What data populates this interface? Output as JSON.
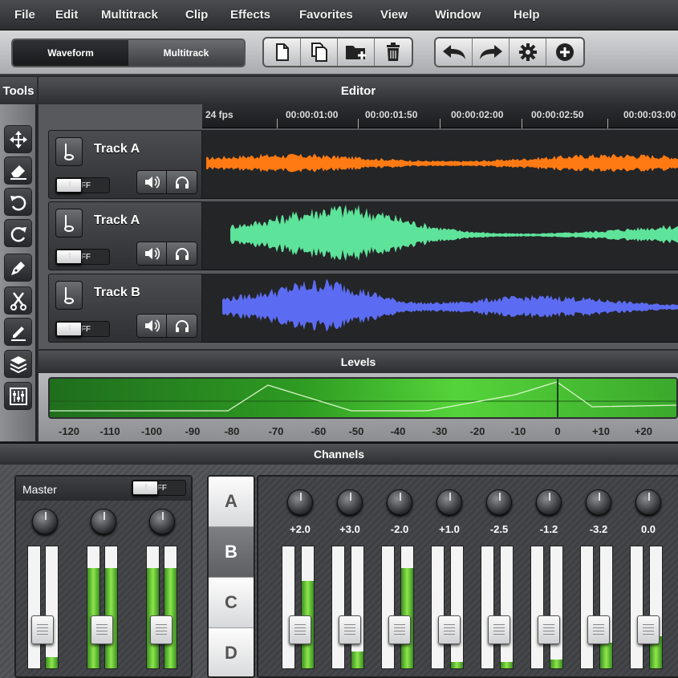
{
  "menu": [
    "File",
    "Edit",
    "Multitrack",
    "Clip",
    "Effects",
    "Favorites",
    "View",
    "Window",
    "Help"
  ],
  "view_tabs": {
    "waveform": "Waveform",
    "multitrack": "Multitrack"
  },
  "file_buttons": [
    "new-file-icon",
    "copy-icon",
    "new-folder-icon",
    "trash-icon"
  ],
  "action_buttons": [
    "undo-icon",
    "redo-icon",
    "settings-icon",
    "add-icon"
  ],
  "tools_title": "Tools",
  "tools": [
    "move-icon",
    "eraser-icon",
    "rotate-left-icon",
    "rotate-right-icon",
    "pen-icon",
    "scissors-icon",
    "pencil-icon",
    "layers-icon",
    "mixer-icon"
  ],
  "editor": {
    "title": "Editor",
    "fps": "24 fps",
    "timecodes": [
      "00:00:01:00",
      "00:00:01:50",
      "00:00:02:00",
      "00:00:02:50",
      "00:00:03:00"
    ],
    "tracks": [
      {
        "name": "Track A",
        "toggle": "OFF",
        "color": "#ff7a12"
      },
      {
        "name": "Track A",
        "toggle": "OFF",
        "color": "#5ee39a"
      },
      {
        "name": "Track B",
        "toggle": "OFF",
        "color": "#5b6cf2"
      }
    ]
  },
  "levels": {
    "title": "Levels",
    "scale": [
      "-120",
      "-110",
      "-100",
      "-90",
      "-80",
      "-70",
      "-60",
      "-50",
      "-40",
      "-30",
      "-20",
      "-10",
      "0",
      "+10",
      "+20"
    ]
  },
  "channels": {
    "title": "Channels",
    "master": {
      "label": "Master",
      "toggle": "OFF",
      "fader_levels": [
        0.09,
        0.82,
        0.82
      ]
    },
    "banks": [
      "A",
      "B",
      "C",
      "D"
    ],
    "selected_bank": "B",
    "strips": [
      {
        "value": "+2.0",
        "level": 0.72
      },
      {
        "value": "+3.0",
        "level": 0.14
      },
      {
        "value": "-2.0",
        "level": 0.82
      },
      {
        "value": "+1.0",
        "level": 0.05
      },
      {
        "value": "-2.5",
        "level": 0.05
      },
      {
        "value": "-1.2",
        "level": 0.07
      },
      {
        "value": "-3.2",
        "level": 0.21
      },
      {
        "value": "0.0",
        "level": 0.26
      }
    ]
  }
}
